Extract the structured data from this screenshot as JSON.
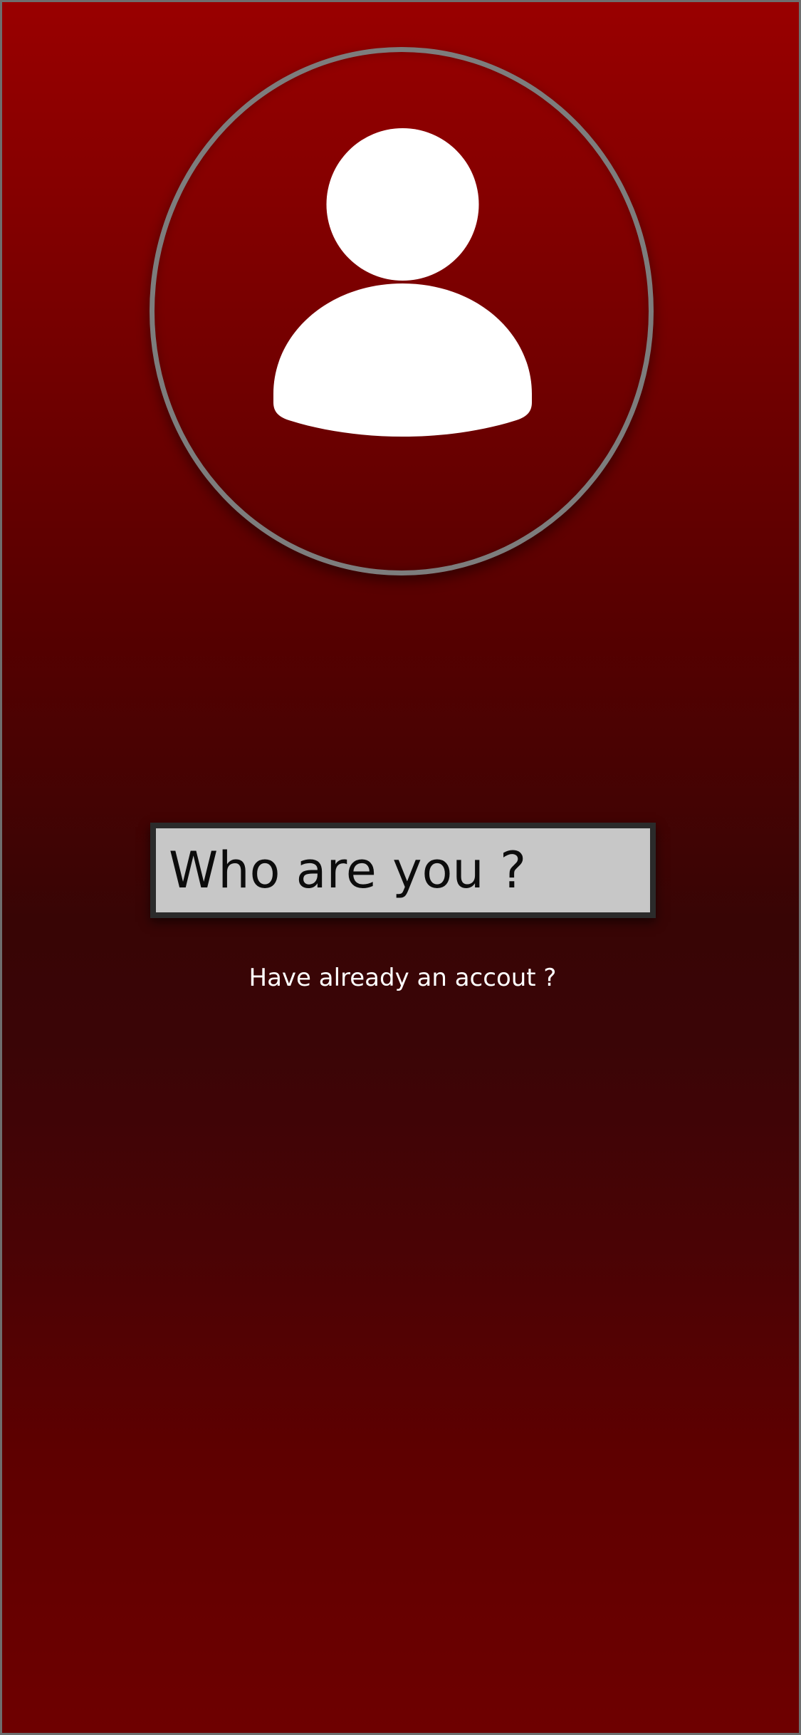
{
  "avatar": {
    "icon": "user-silhouette-icon"
  },
  "name_input": {
    "placeholder": "Who are you ?",
    "value": ""
  },
  "account_link": {
    "label": "Have already an accout ?"
  },
  "colors": {
    "background_top": "#990000",
    "background_mid": "#380505",
    "background_bottom": "#6e0000",
    "ring": "#7d7d7d",
    "input_background": "#c7c7c7",
    "input_border": "#2b2b2b",
    "text_light": "#ffffff"
  }
}
